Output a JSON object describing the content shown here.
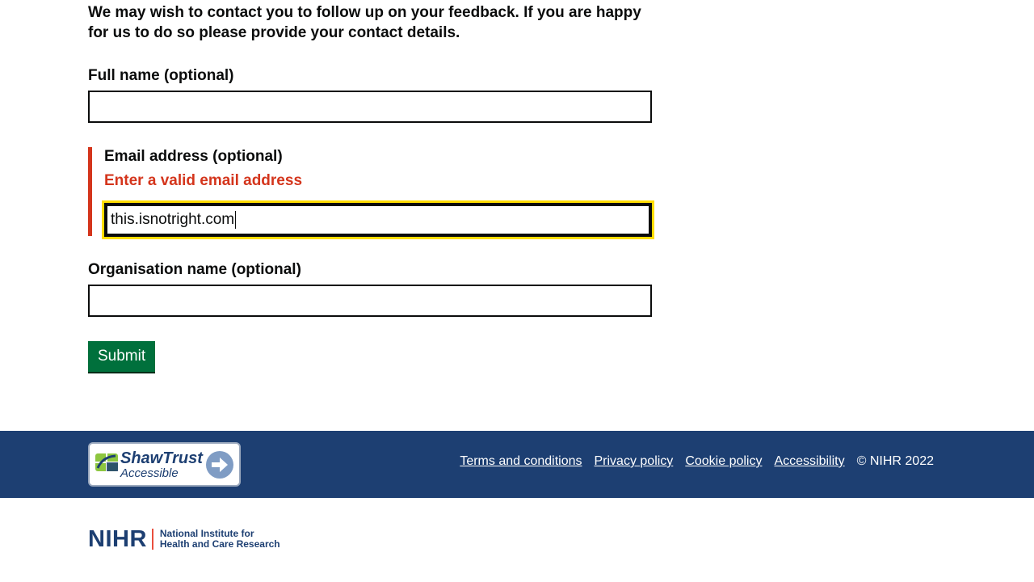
{
  "intro_text": "We may wish to contact you to follow up on your feedback. If you are happy for us to do so please provide your contact details.",
  "form": {
    "full_name": {
      "label": "Full name (optional)",
      "value": ""
    },
    "email": {
      "label": "Email address (optional)",
      "error": "Enter a valid email address",
      "value": "this.isnotright.com"
    },
    "organisation": {
      "label": "Organisation name (optional)",
      "value": ""
    },
    "submit_label": "Submit"
  },
  "footer": {
    "shaw_trust": {
      "line1": "ShawTrust",
      "line2": "Accessible",
      "icon": "arrow-right-icon"
    },
    "links": [
      "Terms and conditions",
      "Privacy policy",
      "Cookie policy",
      "Accessibility"
    ],
    "copyright": "© NIHR 2022"
  },
  "logo": {
    "acronym": "NIHR",
    "line1": "National Institute for",
    "line2": "Health and Care Research"
  },
  "colors": {
    "error": "#d4351c",
    "focus": "#ffdd00",
    "button": "#00703c",
    "footer_bg": "#1d3f72"
  }
}
